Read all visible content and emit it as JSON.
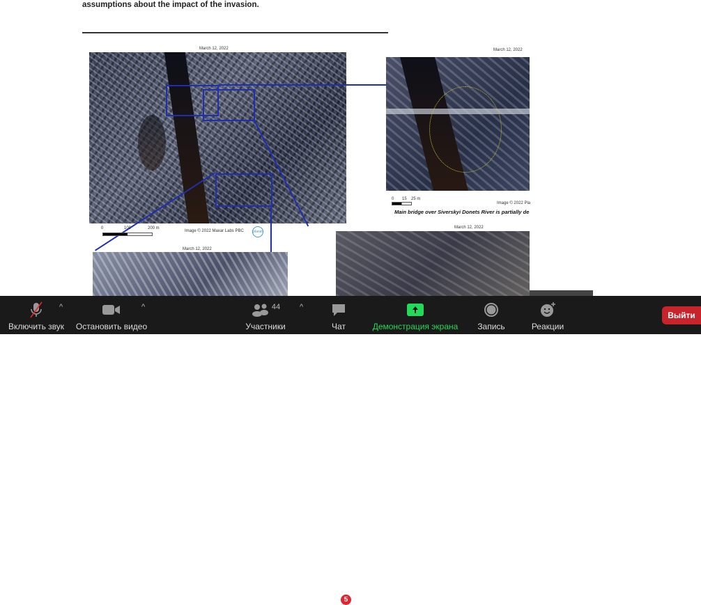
{
  "document": {
    "intro_text": "assumptions about the impact of the invasion.",
    "main_image": {
      "date": "March 12, 2022",
      "scale_labels": [
        "0",
        "100",
        "200 m"
      ],
      "credit": "Image © 2022 Maxar Labs PBC",
      "logo": "planet"
    },
    "right_image": {
      "date": "March 12, 2022",
      "scale_labels": [
        "0",
        "15",
        "25 m"
      ],
      "credit": "Image © 2022 Pla",
      "caption": "Main bridge over Siverskyi Donets River is partially de"
    },
    "bottom_right_image": {
      "date": "March 12, 2022"
    },
    "bottom_left_image": {
      "date": "March 12, 2022"
    }
  },
  "toolbar": {
    "unmute": "Включить звук",
    "stop_video": "Остановить видео",
    "participants": "Участники",
    "participants_count": "44",
    "chat": "Чат",
    "chat_badge": "5",
    "share_screen": "Демонстрация экрана",
    "record": "Запись",
    "reactions": "Реакции",
    "leave": "Выйти",
    "caret": "^"
  },
  "colors": {
    "toolbar_bg": "#1a1a1a",
    "share_green": "#23d959",
    "leave_red": "#c8242b"
  }
}
